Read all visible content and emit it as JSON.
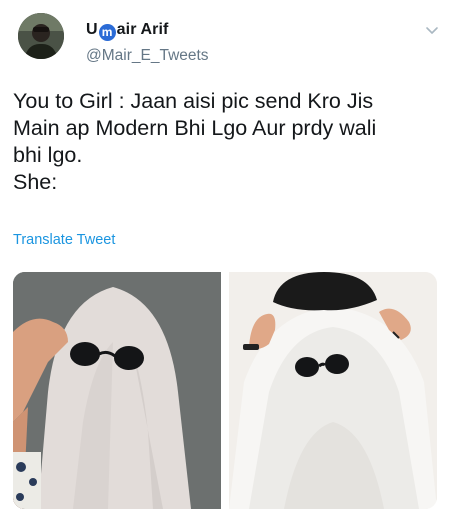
{
  "author": {
    "display_name_prefix": "U",
    "display_name_badge": "m",
    "display_name_suffix": "air Arif",
    "handle": "@Mair_E_Tweets"
  },
  "tweet": {
    "text": "You to Girl : Jaan aisi pic send Kro Jis\nMain ap Modern Bhi Lgo Aur prdy wali\nbhi lgo.\nShe:",
    "translate_label": "Translate Tweet"
  },
  "icons": {
    "more": "chevron-down-icon"
  },
  "colors": {
    "link": "#1b95e0",
    "secondary_text": "#657786",
    "primary_text": "#14171a"
  }
}
